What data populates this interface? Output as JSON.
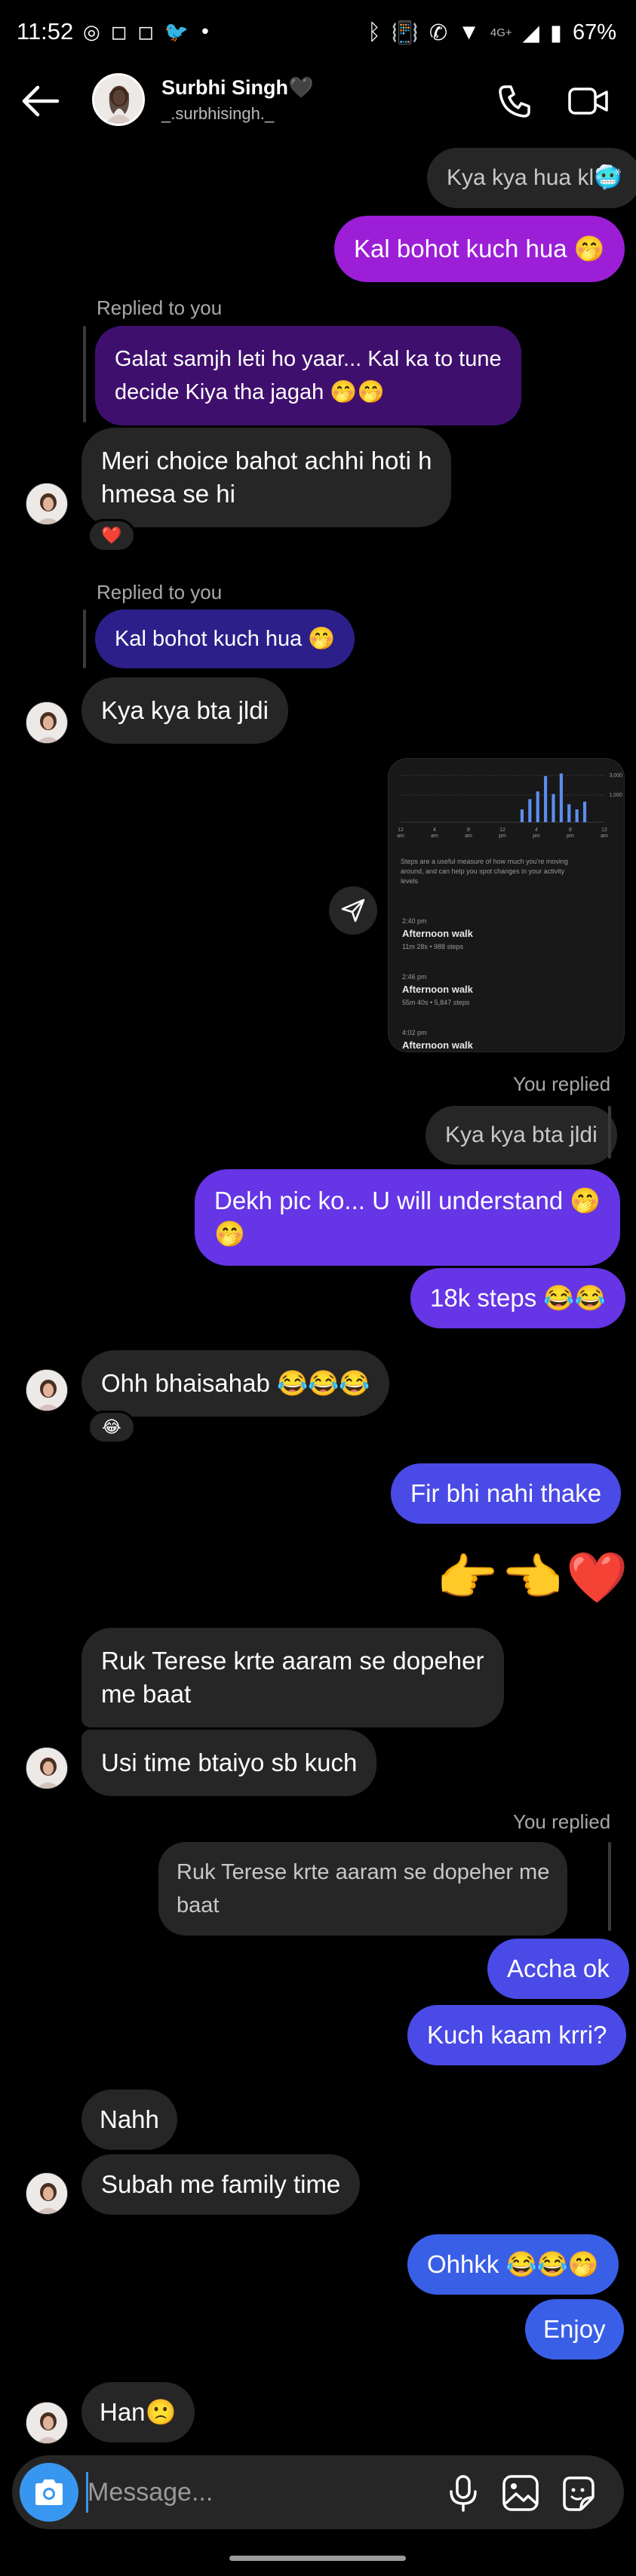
{
  "status_bar": {
    "time": "11:52",
    "left_icons": [
      "whatsapp-icon",
      "instagram-icon",
      "instagram-icon",
      "twitter-icon",
      "dot-icon"
    ],
    "network": "4G+",
    "battery": "67%"
  },
  "header": {
    "name": "Surbhi Singh🖤",
    "handle": "_.surbhisingh._"
  },
  "messages": {
    "m1": "Kya kya hua kl🥶",
    "m2": "Kal bohot kuch hua 🤭",
    "m3_label": "Replied to you",
    "m3_quote_l1": "Galat samjh leti ho yaar... Kal ka to tune",
    "m3_quote_l2": "decide Kiya tha jagah 🤭🤭",
    "m3_l1": "Meri choice bahot achhi hoti h",
    "m3_l2": "hmesa se hi",
    "m3_reaction": "❤️",
    "m4_label": "Replied to you",
    "m4_quote": "Kal bohot kuch hua 🤭",
    "m4": "Kya kya bta jldi",
    "m5_label": "You replied",
    "m5_quote": "Kya kya bta jldi",
    "m6_l1": "Dekh pic ko... U will understand 🤭",
    "m6_l2": "🤭",
    "m7": "18k steps 😂😂",
    "m8": "Ohh bhaisahab 😂😂😂",
    "m8_reaction": "😂",
    "m9": "Fir bhi nahi thake",
    "m10": "👉👈❤️",
    "m11_l1": "Ruk Terese krte aaram se dopeher",
    "m11_l2": "me baat",
    "m12": "Usi time btaiyo sb kuch",
    "m13_label": "You replied",
    "m13_quote_l1": "Ruk Terese krte aaram se dopeher me",
    "m13_quote_l2": "baat",
    "m14": "Accha ok",
    "m15": "Kuch kaam krri?",
    "m16": "Nahh",
    "m17": "Subah me family time",
    "m18": "Ohhkk 😂😂🤭",
    "m19": "Enjoy",
    "m20": "Han🙁"
  },
  "shared_card": {
    "y_ticks": [
      "3,000",
      "1,000"
    ],
    "x_ticks": [
      "12 am",
      "4 am",
      "8 am",
      "12 pm",
      "4 pm",
      "8 pm",
      "12 am"
    ],
    "chart_values": [
      0,
      0,
      0,
      0,
      0,
      0,
      0,
      0,
      0,
      0,
      0,
      0,
      0,
      0,
      0,
      0.25,
      0.45,
      0.6,
      0.9,
      0.55,
      0.95,
      0.35,
      0.25,
      0.4,
      0,
      0
    ],
    "description_l1": "Steps are a useful measure of how much you're moving",
    "description_l2": "around, and can help you spot changes in your activity",
    "description_l3": "levels",
    "walks": [
      {
        "time": "2:40 pm",
        "title": "Afternoon walk",
        "stats": "11m 28s • ⁠988 steps"
      },
      {
        "time": "2:46 pm",
        "title": "Afternoon walk",
        "stats": "55m 40s • ⁠5,847 steps"
      },
      {
        "time": "4:02 pm",
        "title": "Afternoon walk",
        "stats": ""
      }
    ]
  },
  "composer": {
    "placeholder": "Message..."
  },
  "colors": {
    "incoming": "#262626",
    "outgoing_purple": "#9c1fd7",
    "outgoing_violet": "#6535e6",
    "outgoing_blue": "#3a5fe7",
    "camera_button": "#3797f0"
  }
}
